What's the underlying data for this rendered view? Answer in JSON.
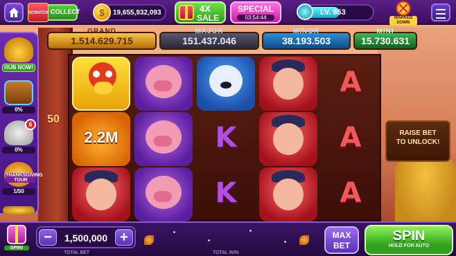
{
  "topbar": {
    "scratch_label": "COLLECT",
    "scratch_ticket": "SCRATCH",
    "coins": "19,655,932,093",
    "sale_multiplier": "4X",
    "sale_label": "SALE",
    "special_label": "SPECIAL",
    "special_timer": "03:54:44",
    "level_label": "LV. 853",
    "level_progress": 0.55,
    "marked_down_label": "MARKED DOWN"
  },
  "jackpots": {
    "grand": {
      "label": "GRAND",
      "value": "1.514.629.715"
    },
    "major": {
      "label": "MAJOR",
      "value": "151.437.046"
    },
    "minor": {
      "label": "MINOR",
      "value": "38.193.503"
    },
    "mini": {
      "label": "MINI",
      "value": "15.730.631"
    }
  },
  "sidepanel": {
    "items": [
      {
        "icon": "magic-lamp-icon",
        "caption": "RUB NOW!"
      },
      {
        "icon": "treasure-chest-icon",
        "caption": "0%"
      },
      {
        "icon": "cooking-pot-icon",
        "caption": "0%",
        "badge": "6"
      },
      {
        "icon": "pie-icon",
        "title": "THANKSGIVING TOUR",
        "caption": "1/50"
      }
    ]
  },
  "reels": {
    "side_number": "50",
    "columns": [
      [
        "rooster",
        "pumpkin",
        "farmer"
      ],
      [
        "pig",
        "pig",
        "pig"
      ],
      [
        "dog",
        "K",
        "K"
      ],
      [
        "farmer",
        "farmer",
        "farmer"
      ],
      [
        "A",
        "A",
        "A"
      ]
    ],
    "pumpkin_value": "2.2M",
    "letters": {
      "k": "K",
      "a": "A"
    }
  },
  "raise_bet_lines": [
    "RAISE BET",
    "TO UNLOCK!"
  ],
  "bottombar": {
    "spin_gift_label": "SPIN!",
    "bet_minus": "−",
    "bet_plus": "+",
    "total_bet_value": "1,500,000",
    "total_bet_caption": "TOTAL BET",
    "total_win_caption": "TOTAL WIN",
    "maxbet_line1": "MAX",
    "maxbet_line2": "BET",
    "spin_label": "SPIN",
    "spin_sub": "HOLD FOR AUTO"
  }
}
